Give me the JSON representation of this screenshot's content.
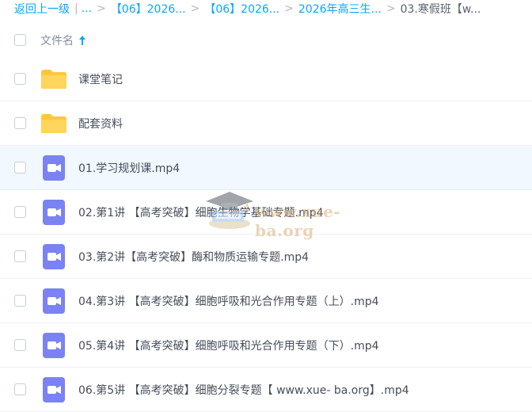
{
  "breadcrumb": {
    "back_label": "返回上一级",
    "ellipsis": "...",
    "items": [
      "【06】2026...",
      "【06】2026...",
      "2026年高三生..."
    ],
    "current": "03.寒假班【w..."
  },
  "header": {
    "name_label": "文件名"
  },
  "files": [
    {
      "name": "课堂笔记",
      "type": "folder"
    },
    {
      "name": "配套资料",
      "type": "folder"
    },
    {
      "name": "01.学习规划课.mp4",
      "type": "video"
    },
    {
      "name": "02.第1讲 【高考突破】细胞生物学基础专题.mp4",
      "type": "video"
    },
    {
      "name": "03.第2讲【高考突破】酶和物质运输专题.mp4",
      "type": "video"
    },
    {
      "name": "04.第3讲 【高考突破】细胞呼吸和光合作用专题（上）.mp4",
      "type": "video"
    },
    {
      "name": "05.第4讲 【高考突破】细胞呼吸和光合作用专题（下）.mp4",
      "type": "video"
    },
    {
      "name": "06.第5讲 【高考突破】细胞分裂专题【 www.xue- ba.org】.mp4",
      "type": "video"
    }
  ],
  "watermark": {
    "text": "www.xue-ba.org"
  },
  "colors": {
    "accent": "#06a7ff",
    "folder": "#ffc63d",
    "video": "#7b82f2",
    "row_highlight": "#f2f8ff"
  }
}
